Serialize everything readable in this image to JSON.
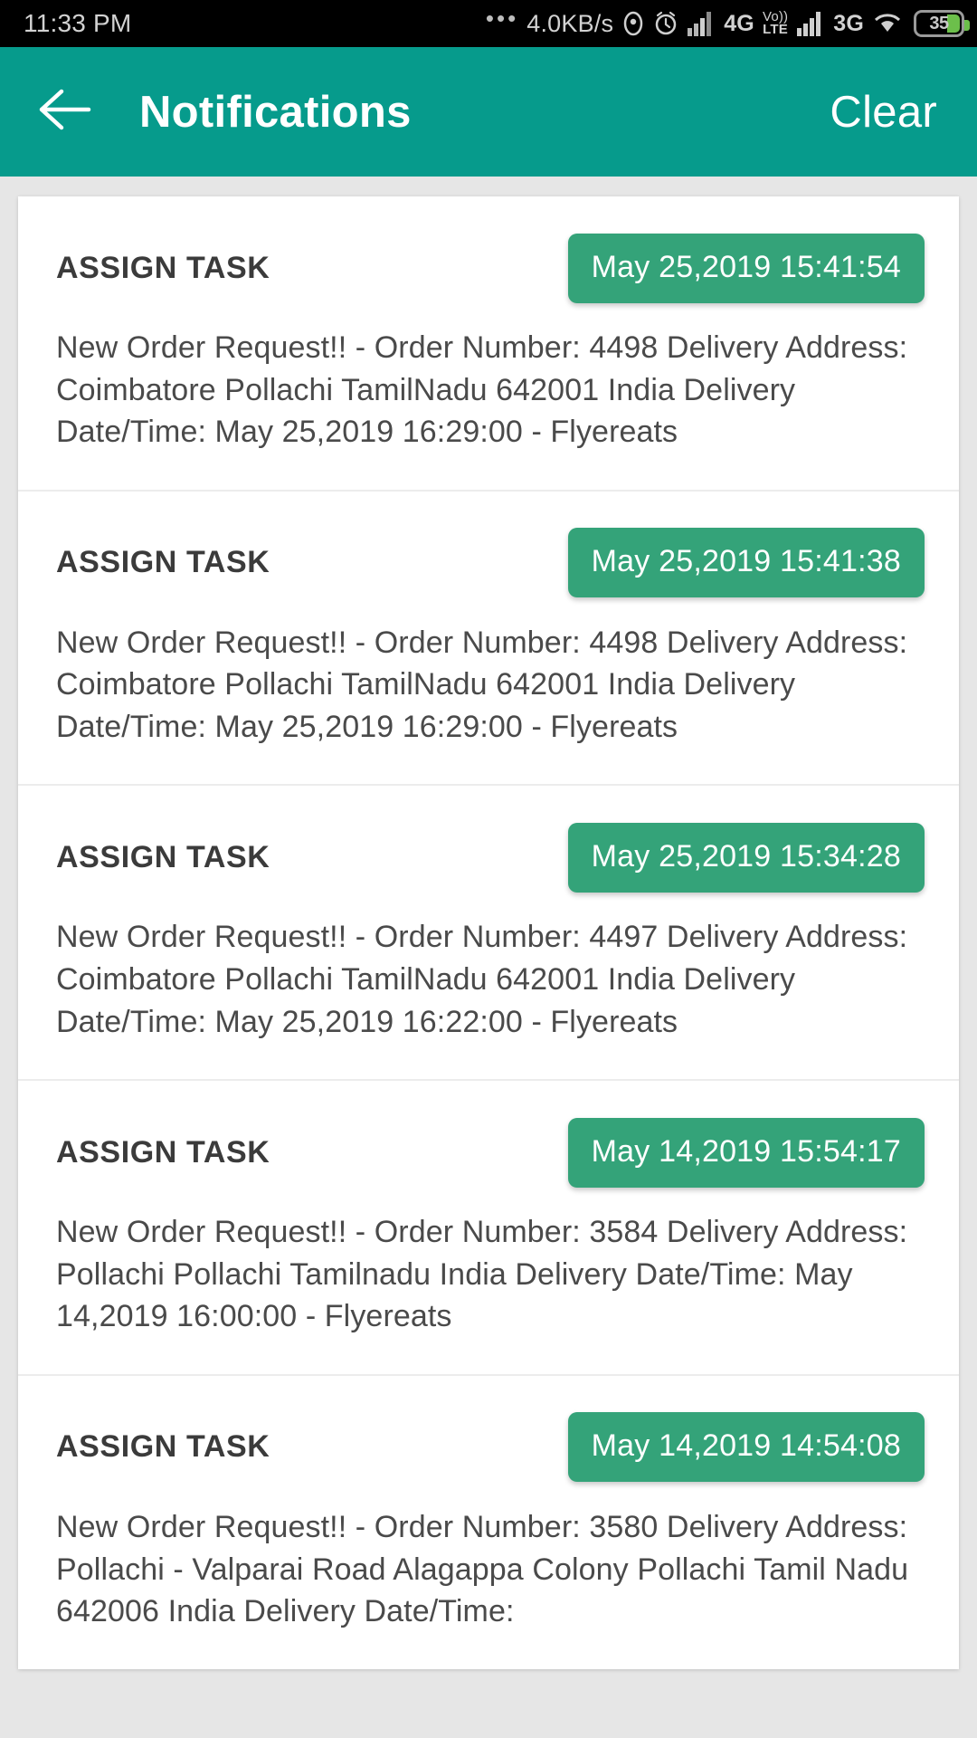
{
  "statusbar": {
    "clock": "11:33 PM",
    "dots": "•••",
    "network_speed": "4.0KB/s",
    "location_icon": "location-icon",
    "alarm_icon": "alarm-icon",
    "signal_icon_1": "signal-bars-icon",
    "network_1": "4G",
    "volte_top": "Vo))",
    "volte_bottom": "LTE",
    "signal_icon_2": "signal-bars-icon",
    "network_2": "3G",
    "wifi_icon": "wifi-icon",
    "battery_level": "35"
  },
  "appbar": {
    "back_icon": "back-arrow-icon",
    "title": "Notifications",
    "clear_label": "Clear",
    "background_color": "#069b8c"
  },
  "theme": {
    "badge_color": "#34a379",
    "page_background": "#e6e6e6",
    "card_background": "#ffffff"
  },
  "notifications": [
    {
      "type": "ASSIGN TASK",
      "timestamp": "May 25,2019 15:41:54",
      "body": "New Order Request!! - Order Number: 4498 Delivery Address: Coimbatore Pollachi TamilNadu 642001 India Delivery Date/Time: May 25,2019 16:29:00 - Flyereats"
    },
    {
      "type": "ASSIGN TASK",
      "timestamp": "May 25,2019 15:41:38",
      "body": "New Order Request!! - Order Number: 4498 Delivery Address: Coimbatore Pollachi TamilNadu 642001 India Delivery Date/Time: May 25,2019 16:29:00 - Flyereats"
    },
    {
      "type": "ASSIGN TASK",
      "timestamp": "May 25,2019 15:34:28",
      "body": "New Order Request!! - Order Number: 4497 Delivery Address: Coimbatore Pollachi TamilNadu 642001 India Delivery Date/Time: May 25,2019 16:22:00 - Flyereats"
    },
    {
      "type": "ASSIGN TASK",
      "timestamp": "May 14,2019 15:54:17",
      "body": "New Order Request!! - Order Number: 3584 Delivery Address: Pollachi Pollachi Tamilnadu India Delivery Date/Time: May 14,2019 16:00:00 - Flyereats"
    },
    {
      "type": "ASSIGN TASK",
      "timestamp": "May 14,2019 14:54:08",
      "body": "New Order Request!! - Order Number: 3580 Delivery Address: Pollachi - Valparai Road Alagappa Colony Pollachi Tamil Nadu 642006 India Delivery Date/Time:"
    }
  ]
}
